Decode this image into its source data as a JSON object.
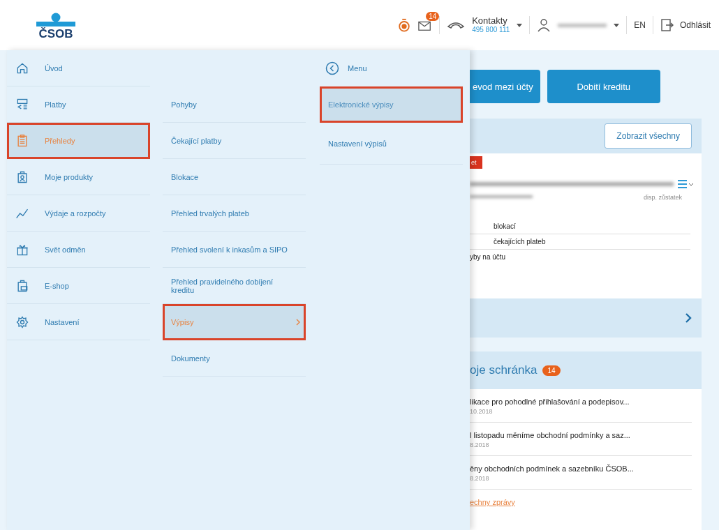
{
  "header": {
    "logo": "ČSOB",
    "mail_count": "14",
    "contacts": {
      "label": "Kontakty",
      "phone": "495 800 111"
    },
    "language": "EN",
    "logout": "Odhlásit"
  },
  "menu": {
    "main": [
      {
        "label": "Úvod",
        "kind": "home",
        "selected": false
      },
      {
        "label": "Platby",
        "kind": "payments",
        "selected": false
      },
      {
        "label": "Přehledy",
        "kind": "overview",
        "selected": true
      },
      {
        "label": "Moje produkty",
        "kind": "products",
        "selected": false
      },
      {
        "label": "Výdaje a rozpočty",
        "kind": "budget",
        "selected": false
      },
      {
        "label": "Svět odměn",
        "kind": "rewards",
        "selected": false
      },
      {
        "label": "E-shop",
        "kind": "shop",
        "selected": false
      },
      {
        "label": "Nastavení",
        "kind": "settings",
        "selected": false
      }
    ],
    "sub": [
      {
        "label": "Pohyby",
        "selected": false
      },
      {
        "label": "Čekající platby",
        "selected": false
      },
      {
        "label": "Blokace",
        "selected": false
      },
      {
        "label": "Přehled trvalých plateb",
        "selected": false
      },
      {
        "label": "Přehled svolení k inkasům a SIPO",
        "selected": false
      },
      {
        "label": "Přehled pravidelného dobíjení kreditu",
        "selected": false
      },
      {
        "label": "Výpisy",
        "selected": true
      },
      {
        "label": "Dokumenty",
        "selected": false
      }
    ],
    "third": {
      "back": "Menu",
      "items": [
        {
          "label": "Elektronické výpisy",
          "selected": true
        },
        {
          "label": "Nastavení výpisů",
          "selected": false
        }
      ]
    }
  },
  "page": {
    "buttons": [
      "evod mezi účty",
      "Dobití kreditu"
    ],
    "show_all": "Zobrazit všechny",
    "account": {
      "tag": "et",
      "balance_label": "disp. zůstatek",
      "links": [
        "blokací",
        "čekajících plateb",
        "yby na účtu"
      ]
    },
    "inbox": {
      "title": "oje schránka",
      "count": "14",
      "messages": [
        {
          "title": "likace pro pohodlné přihlašování a podepisov...",
          "date": "10.2018"
        },
        {
          "title": "l listopadu měníme obchodní podmínky a saz...",
          "date": "8.2018"
        },
        {
          "title": "ěny obchodních podmínek a sazebníku ČSOB...",
          "date": "8.2018"
        }
      ],
      "all_link": "echny zprávy"
    }
  }
}
